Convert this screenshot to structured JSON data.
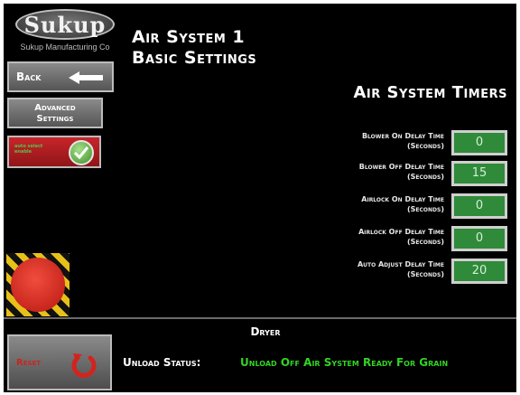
{
  "logo": {
    "word": "Sukup",
    "tagline": "Sukup Manufacturing Co"
  },
  "header": {
    "title_line1": "Air System 1",
    "title_line2": "Basic Settings"
  },
  "left_panel": {
    "back_label": "Back",
    "advanced_label_line1": "Advanced",
    "advanced_label_line2": "Settings",
    "auto_mode_text": "auto select enable"
  },
  "timers": {
    "title": "Air System Timers",
    "rows": [
      {
        "label": "Blower On Delay Time",
        "unit": "(Seconds)",
        "value": "0"
      },
      {
        "label": "Blower Off Delay Time",
        "unit": "(Seconds)",
        "value": "15"
      },
      {
        "label": "Airlock On Delay Time",
        "unit": "(Seconds)",
        "value": "0"
      },
      {
        "label": "Airlock Off Delay Time",
        "unit": "(Seconds)",
        "value": "0"
      },
      {
        "label": "Auto Adjust Delay Time",
        "unit": "(Seconds)",
        "value": "20"
      }
    ]
  },
  "footer": {
    "section_label": "Dryer",
    "reset_label": "Reset",
    "unload_label": "Unload Status:",
    "unload_value": "Unload Off Air System Ready for Grain"
  },
  "colors": {
    "background": "#000000",
    "value_box": "#2f8a3a",
    "status_text": "#33d424",
    "estop": "#c9271e",
    "auto_button": "#c7252a"
  },
  "icons": {
    "back": "back-arrow-icon",
    "auto": "checkmark-icon",
    "reset": "reset-circular-arrow-icon",
    "estop": "emergency-stop-icon"
  }
}
